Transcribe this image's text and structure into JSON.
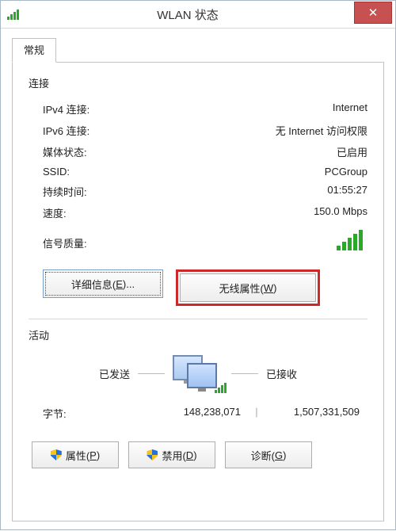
{
  "window": {
    "title": "WLAN 状态"
  },
  "tab": {
    "general": "常规"
  },
  "connection": {
    "heading": "连接",
    "ipv4_label": "IPv4 连接:",
    "ipv4_value": "Internet",
    "ipv6_label": "IPv6 连接:",
    "ipv6_value": "无 Internet 访问权限",
    "media_label": "媒体状态:",
    "media_value": "已启用",
    "ssid_label": "SSID:",
    "ssid_value": "PCGroup",
    "duration_label": "持续时间:",
    "duration_value": "01:55:27",
    "speed_label": "速度:",
    "speed_value": "150.0 Mbps",
    "signal_label": "信号质量:"
  },
  "buttons": {
    "details_pre": "详细信息(",
    "details_key": "E",
    "details_post": ")...",
    "wireless_pre": "无线属性(",
    "wireless_key": "W",
    "wireless_post": ")",
    "properties_pre": "属性(",
    "properties_key": "P",
    "properties_post": ")",
    "disable_pre": "禁用(",
    "disable_key": "D",
    "disable_post": ")",
    "diagnose_pre": "诊断(",
    "diagnose_key": "G",
    "diagnose_post": ")"
  },
  "activity": {
    "heading": "活动",
    "sent": "已发送",
    "received": "已接收",
    "bytes_label": "字节:",
    "bytes_sent": "148,238,071",
    "bytes_received": "1,507,331,509",
    "divider": "|"
  }
}
